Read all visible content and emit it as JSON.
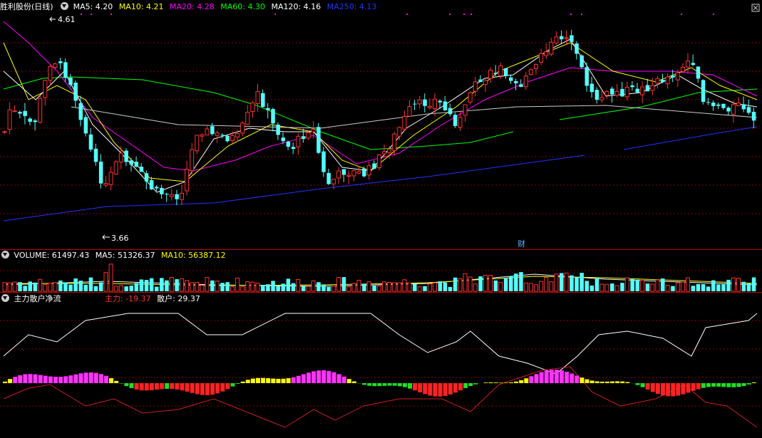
{
  "main_panel": {
    "title": "胜利股份(日线)",
    "ma_labels": [
      {
        "text": "MA5: 4.20",
        "color": "#ffffff"
      },
      {
        "text": "MA10: 4.21",
        "color": "#ffff00"
      },
      {
        "text": "MA20: 4.28",
        "color": "#ff00ff"
      },
      {
        "text": "MA60: 4.30",
        "color": "#00ff00"
      },
      {
        "text": "MA120: 4.16",
        "color": "#ffffff"
      },
      {
        "text": "MA250: 4.13",
        "color": "#2233ff"
      }
    ],
    "high_marker": "4.61",
    "low_marker": "3.66",
    "event_marker": "财"
  },
  "volume_panel": {
    "labels": [
      {
        "text": "VOLUME: 61497.43",
        "color": "#ffffff"
      },
      {
        "text": "MA5: 51326.37",
        "color": "#ffffff"
      },
      {
        "text": "MA10: 56387.12",
        "color": "#ffff00"
      }
    ]
  },
  "indicator_panel": {
    "title": "主力散户净流",
    "main_force_label": "主力: -19.37",
    "retail_label": "散户: 29.37",
    "main_force_color": "#ff3333",
    "retail_color": "#ffffff"
  },
  "colors": {
    "up": "#ff3232",
    "down": "#54ffff",
    "grid": "#8b0000",
    "divider": "#c00000"
  },
  "chart_data": {
    "type": "candlestick",
    "price_range_estimate": [
      3.6,
      4.7
    ],
    "marked_high": 4.61,
    "marked_low": 3.66
  }
}
